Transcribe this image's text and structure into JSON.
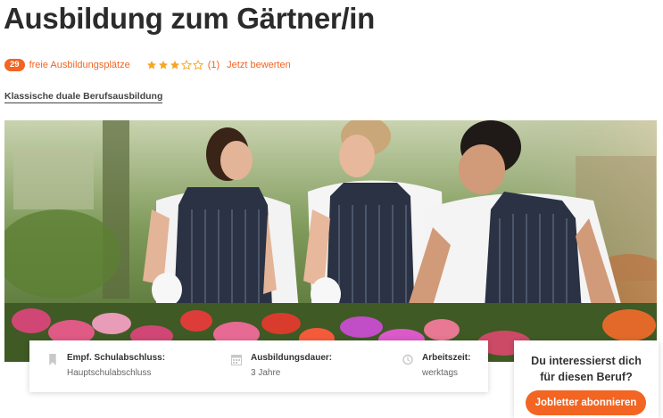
{
  "page": {
    "title": "Ausbildung zum Gärtner/in",
    "subtitle": "Klassische duale Berufsausbildung"
  },
  "meta": {
    "free_count": "29",
    "free_label": "freie Ausbildungsplätze",
    "rating": 3,
    "rating_max": 5,
    "rating_count": "(1)",
    "rate_link": "Jetzt bewerten"
  },
  "colors": {
    "accent": "#f26522",
    "star_filled": "#f5a623",
    "star_empty": "#f5a623"
  },
  "hero_image": {
    "description_icon": "photo-gardeners"
  },
  "info": [
    {
      "icon": "bookmark-icon",
      "label": "Empf. Schulabschluss:",
      "value": "Hauptschulabschluss"
    },
    {
      "icon": "calendar-icon",
      "label": "Ausbildungsdauer:",
      "value": "3 Jahre"
    },
    {
      "icon": "clock-icon",
      "label": "Arbeitszeit:",
      "value": "werktags"
    }
  ],
  "cta": {
    "line1": "Du interessierst dich",
    "line2": "für diesen Beruf?",
    "button": "Jobletter abonnieren"
  }
}
